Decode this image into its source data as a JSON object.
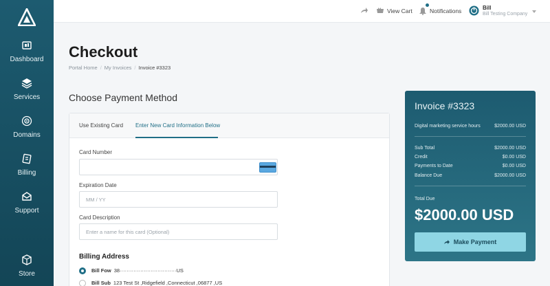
{
  "sidebar": {
    "items": [
      {
        "label": "Dashboard",
        "icon": "dashboard-icon"
      },
      {
        "label": "Services",
        "icon": "services-icon"
      },
      {
        "label": "Domains",
        "icon": "domains-icon"
      },
      {
        "label": "Billing",
        "icon": "billing-icon"
      },
      {
        "label": "Support",
        "icon": "support-icon"
      },
      {
        "label": "Store",
        "icon": "store-icon"
      }
    ]
  },
  "topbar": {
    "view_cart": "View Cart",
    "notifications": "Notifications",
    "user_name": "Bill",
    "user_company": "Bill Testing Company"
  },
  "page": {
    "title": "Checkout",
    "breadcrumb": [
      "Portal Home",
      "My Invoices",
      "Invoice #3323"
    ],
    "section_title": "Choose Payment Method"
  },
  "payment": {
    "tabs": [
      "Use Existing Card",
      "Enter New Card Information Below"
    ],
    "card_number_label": "Card Number",
    "card_number_value": "",
    "expiration_label": "Expiration Date",
    "expiration_placeholder": "MM / YY",
    "description_label": "Card Description",
    "description_placeholder": "Enter a name for this card (Optional)",
    "billing_title": "Billing Address",
    "addresses": [
      {
        "name": "Bill Fow",
        "address": "38·································US",
        "selected": true
      },
      {
        "name": "Bill Sub",
        "address": "123 Test St ,Ridgefield ,Connecticut ,06877 ,US",
        "selected": false
      }
    ]
  },
  "invoice": {
    "title": "Invoice #3323",
    "item_label": "Digital marketing service hours",
    "item_value": "$2000.00 USD",
    "subtotal_label": "Sub Total",
    "subtotal_value": "$2000.00 USD",
    "credit_label": "Credit",
    "credit_value": "$0.00 USD",
    "payments_label": "Payments to Date",
    "payments_value": "$0.00 USD",
    "balance_label": "Balance Due",
    "balance_value": "$2000.00 USD",
    "total_label": "Total Due",
    "total_value": "$2000.00 USD",
    "pay_button": "Make Payment"
  },
  "colors": {
    "accent": "#1f6e86",
    "sidebar": "#1d5b70",
    "pay_button": "#8fd6e4"
  }
}
